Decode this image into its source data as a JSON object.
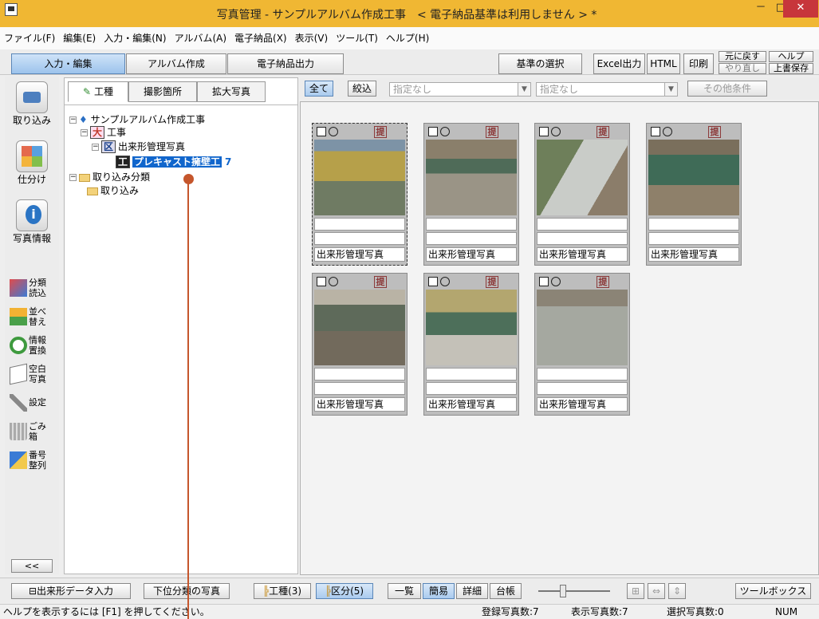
{
  "window": {
    "title": "写真管理 - サンプルアルバム作成工事　< 電子納品基準は利用しません > *",
    "minimize": "－",
    "maximize": "□",
    "close": "✕"
  },
  "menu": [
    "ファイル(F)",
    "編集(E)",
    "入力・編集(N)",
    "アルバム(A)",
    "電子納品(X)",
    "表示(V)",
    "ツール(T)",
    "ヘルプ(H)"
  ],
  "toolbar": {
    "tabs": [
      "入力・編集",
      "アルバム作成",
      "電子納品出力"
    ],
    "criteria": "基準の選択",
    "excel": "Excel出力",
    "html": "HTML",
    "print": "印刷",
    "undo": "元に戻す",
    "redo": "やり直し",
    "help": "ヘルプ",
    "overwrite": "上書保存"
  },
  "leftbar": {
    "import": "取り込み",
    "sort": "仕分け",
    "info": "写真情報",
    "small": [
      {
        "label": "分類\n読込",
        "icon": "classify-load-icon"
      },
      {
        "label": "並べ\n替え",
        "icon": "reorder-icon"
      },
      {
        "label": "情報\n置換",
        "icon": "replace-icon"
      },
      {
        "label": "空白\n写真",
        "icon": "blank-photo-icon"
      },
      {
        "label": "設定",
        "icon": "wrench-icon"
      },
      {
        "label": "ごみ\n箱",
        "icon": "trash-icon"
      },
      {
        "label": "番号\n整列",
        "icon": "number-sort-icon"
      }
    ],
    "collapse": "<<"
  },
  "tree": {
    "tabs": [
      "工種",
      "撮影箇所",
      "拡大写真"
    ],
    "root": "サンプルアルバム作成工事",
    "n1": {
      "badge": "大",
      "label": "工事"
    },
    "n2": {
      "badge": "区",
      "label": "出来形管理写真"
    },
    "n3": {
      "badge": "工",
      "label": "プレキャスト擁壁工",
      "count": "7"
    },
    "n4": "取り込み分類",
    "n5": "取り込み"
  },
  "filter": {
    "all": "全て",
    "narrow": "絞込",
    "select1": "指定なし",
    "select2": "指定なし",
    "other": "その他条件"
  },
  "photos": {
    "mark": "提",
    "captions": [
      "出来形管理写真",
      "出来形管理写真",
      "出来形管理写真",
      "出来形管理写真",
      "出来形管理写真",
      "出来形管理写真",
      "出来形管理写真"
    ]
  },
  "bottom": {
    "dekigata": "出来形データ入力",
    "lower": "下位分類の写真",
    "koushu": "工種(3)",
    "kubun": "区分(5)",
    "list": "一覧",
    "simple": "簡易",
    "detail": "詳細",
    "ledger": "台帳",
    "toolbox": "ツールボックス"
  },
  "status": {
    "help": "ヘルプを表示するには [F1] を押してください。",
    "registered": "登録写真数:7",
    "displayed": "表示写真数:7",
    "selected": "選択写真数:0",
    "num": "NUM"
  },
  "colors": {
    "title_bar": "#f0b733",
    "accent": "#1166cc",
    "marker": "#c5562c"
  }
}
